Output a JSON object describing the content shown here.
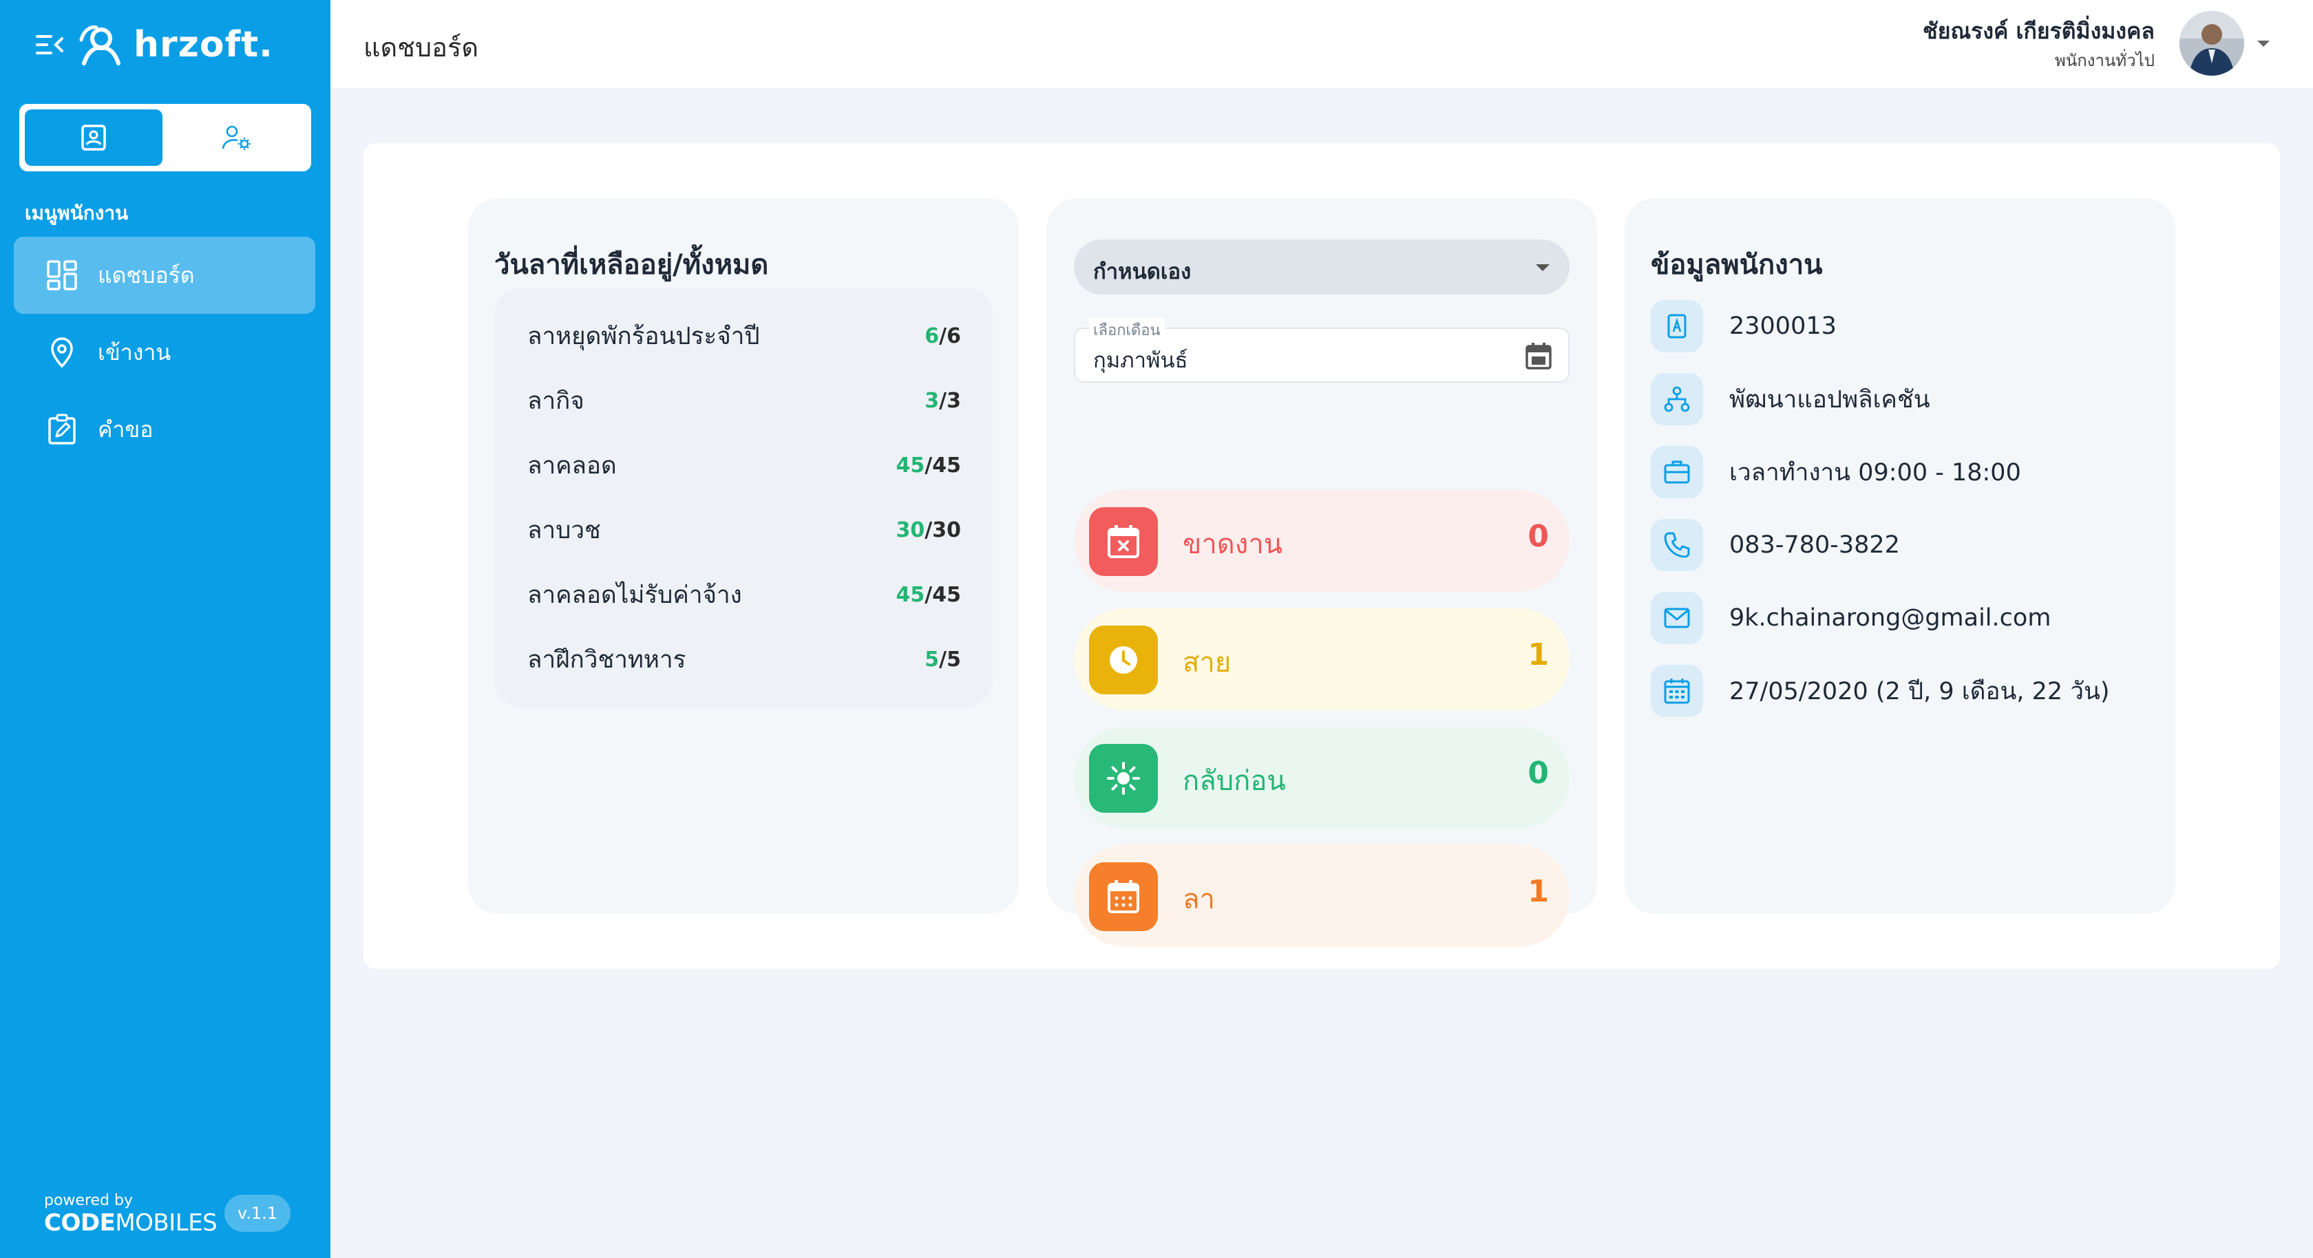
{
  "sidebar": {
    "brand": "hrzoft.",
    "menu_heading": "เมนูพนักงาน",
    "items": [
      {
        "label": "แดชบอร์ด",
        "icon": "dashboard-icon",
        "active": true
      },
      {
        "label": "เข้างาน",
        "icon": "location-pin-icon",
        "active": false
      },
      {
        "label": "คำขอ",
        "icon": "edit-clipboard-icon",
        "active": false
      }
    ],
    "powered_by": "powered by",
    "powered_brand_bold": "CODE",
    "powered_brand_rest": "MOBILES",
    "version": "v.1.1"
  },
  "header": {
    "title": "แดชบอร์ด",
    "user_name": "ชัยณรงค์ เกียรติมิ่งมงคล",
    "user_role": "พนักงานทั่วไป"
  },
  "leave": {
    "title": "วันลาที่เหลืออยู่/ทั้งหมด",
    "items": [
      {
        "name": "ลาหยุดพักร้อนประจำปี",
        "remaining": "6",
        "total": "/6"
      },
      {
        "name": "ลากิจ",
        "remaining": "3",
        "total": "/3"
      },
      {
        "name": "ลาคลอด",
        "remaining": "45",
        "total": "/45"
      },
      {
        "name": "ลาบวช",
        "remaining": "30",
        "total": "/30"
      },
      {
        "name": "ลาคลอดไม่รับค่าจ้าง",
        "remaining": "45",
        "total": "/45"
      },
      {
        "name": "ลาฝึกวิชาทหาร",
        "remaining": "5",
        "total": "/5"
      }
    ]
  },
  "filter": {
    "mode": "กำหนดเอง",
    "month_label": "เลือกเดือน",
    "month_value": "กุมภาพันธ์"
  },
  "stats": {
    "absent": {
      "label": "ขาดงาน",
      "value": "0"
    },
    "late": {
      "label": "สาย",
      "value": "1"
    },
    "early_leave": {
      "label": "กลับก่อน",
      "value": "0"
    },
    "leave": {
      "label": "ลา",
      "value": "1"
    }
  },
  "employee": {
    "title": "ข้อมูลพนักงาน",
    "id": "2300013",
    "department": "พัฒนาแอปพลิเคชัน",
    "work_hours": "เวลาทำงาน 09:00 - 18:00",
    "phone": "083-780-3822",
    "email": "9k.chainarong@gmail.com",
    "start_date": "27/05/2020 (2 ปี, 9 เดือน, 22 วัน)"
  },
  "colors": {
    "primary": "#0a9ee6",
    "absent": "#f05656",
    "late": "#e3ad08",
    "early": "#22b573",
    "leave": "#f27a24"
  }
}
